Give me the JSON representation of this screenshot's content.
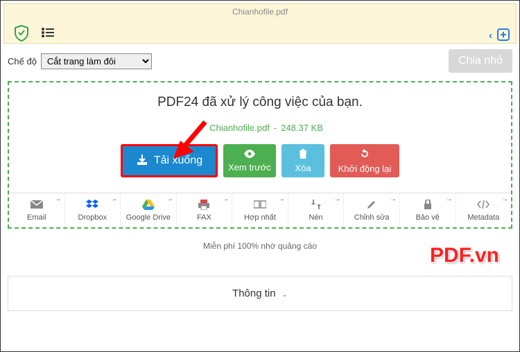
{
  "header": {
    "filename": "Chianhofile.pdf"
  },
  "mode": {
    "label": "Chế độ",
    "selected": "Cắt trang làm đôi"
  },
  "split_button": "Chia nhỏ",
  "result": {
    "title": "PDF24 đã xử lý công việc của bạn.",
    "filename": "Chianhofile.pdf",
    "filesize": "248.37 KB"
  },
  "buttons": {
    "download": "Tải xuống",
    "preview": "Xem trước",
    "delete": "Xóa",
    "restart": "Khởi động lại"
  },
  "actions": {
    "email": "Email",
    "dropbox": "Dropbox",
    "gdrive": "Google Drive",
    "fax": "FAX",
    "merge": "Hợp nhất",
    "compress": "Nén",
    "edit": "Chỉnh sửa",
    "protect": "Bảo vệ",
    "metadata": "Metadata"
  },
  "ad_text": "Miễn phí 100% nhờ quảng cáo",
  "info_label": "Thông tin",
  "watermark": "PDF.vn"
}
